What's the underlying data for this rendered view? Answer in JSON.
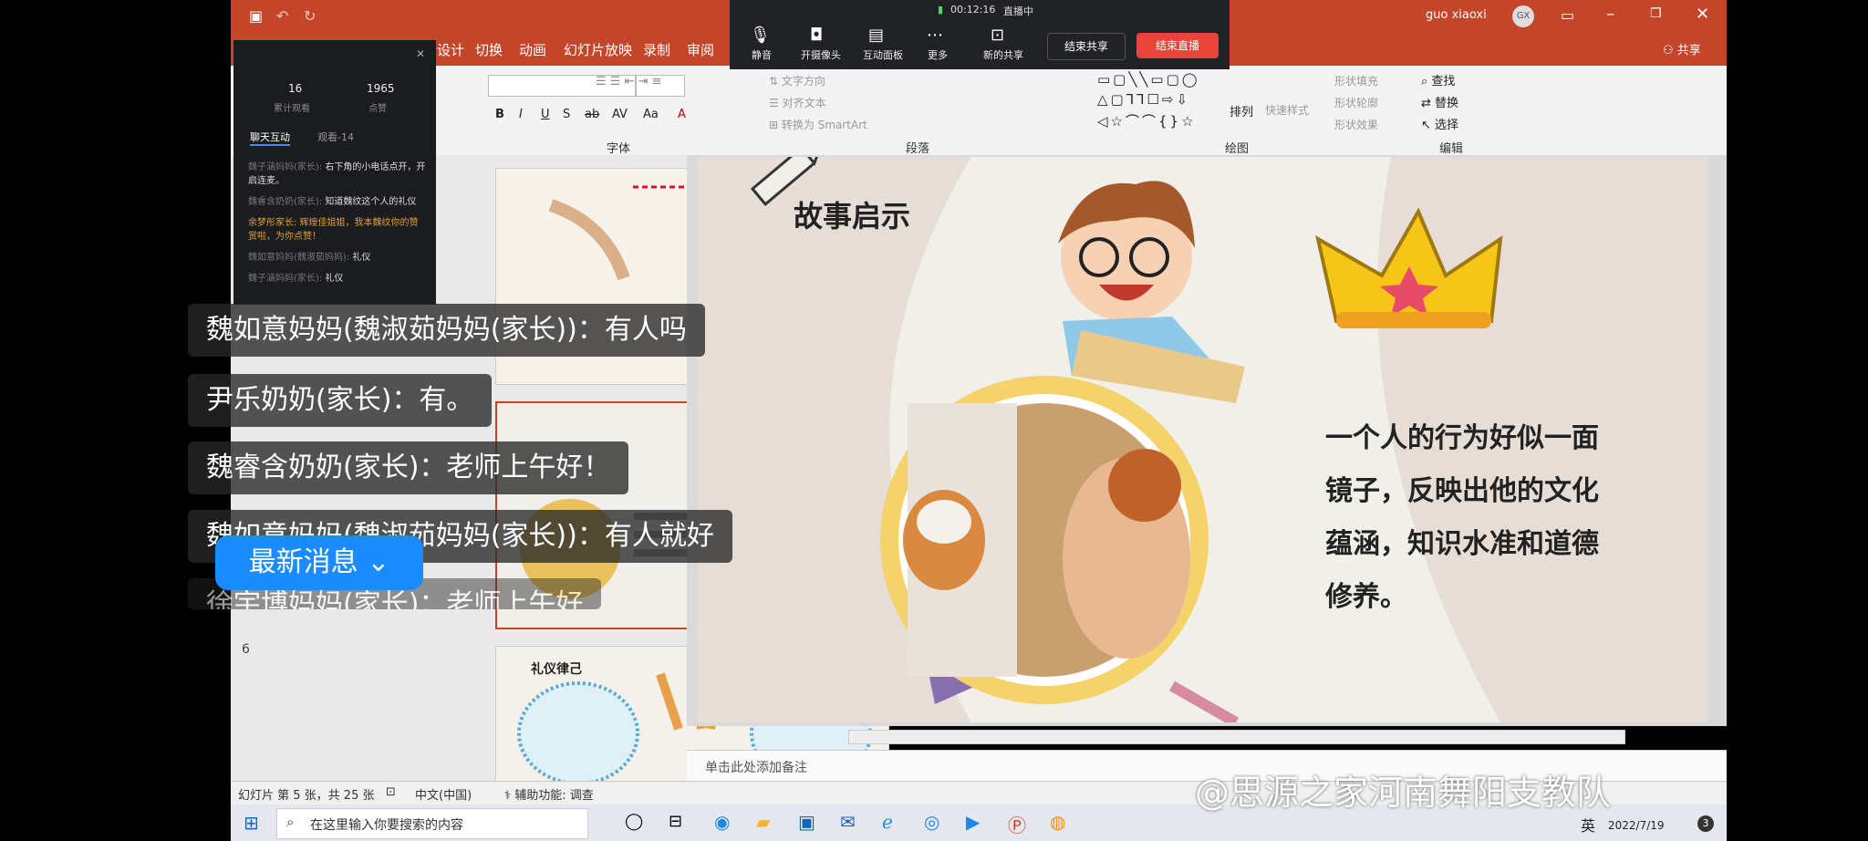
{
  "app": {
    "user_name": "guo xiaoxi",
    "user_initials": "GX",
    "share_label": "共享",
    "tabs": [
      "设计",
      "切换",
      "动画",
      "幻灯片放映",
      "录制",
      "审阅"
    ]
  },
  "meeting": {
    "timer": "00:12:16",
    "live_status": "直播中",
    "buttons": [
      "静音",
      "开摄像头",
      "互动面板",
      "更多",
      "新的共享"
    ],
    "stop_share": "结束共享",
    "end_live": "结束直播"
  },
  "ribbon": {
    "groups": [
      "字体",
      "段落",
      "绘图",
      "编辑"
    ],
    "font_buttons": [
      "B",
      "I",
      "U",
      "S",
      "ab",
      "AV",
      "Aa",
      "A"
    ],
    "para_items": [
      "文字方向",
      "对齐文本",
      "转换为 SmartArt"
    ],
    "draw_items": [
      "排列",
      "快速样式",
      "形状填充",
      "形状轮廓",
      "形状效果"
    ],
    "edit_items": [
      "查找",
      "替换",
      "选择"
    ]
  },
  "panel": {
    "stats": [
      {
        "value": "16",
        "label": "累计观看"
      },
      {
        "value": "1965",
        "label": "点赞"
      }
    ],
    "tabs": [
      "聊天互动",
      "观看-14"
    ],
    "messages": [
      {
        "user": "魏子涵妈妈(家长):",
        "text": "右下角的小电话点开，开启连麦。"
      },
      {
        "user": "魏睿含奶奶(家长):",
        "text": "知道魏纹这个人的礼仪"
      },
      {
        "user": "余梦彤家长:",
        "text": "辉煌佳姐姐，我本魏纹你的赞赏啦，为你点赞！"
      },
      {
        "user": "魏如意妈妈(魏淑茹妈妈):",
        "text": "礼仪"
      },
      {
        "user": "魏子涵妈妈(家长):",
        "text": "礼仪"
      }
    ]
  },
  "chat_overlay": [
    "魏如意妈妈(魏淑茹妈妈(家长))：有人吗",
    "尹乐奶奶(家长)：有。",
    "魏睿含奶奶(家长)：老师上午好！",
    "魏如意妈妈(魏淑茹妈妈(家长))：有人就好",
    "徐宇博妈妈(家长)：老师上午好"
  ],
  "new_message_button": "最新消息",
  "slide": {
    "title": "故事启示",
    "body": [
      "一个人的行为好似一面",
      "镜子，反映出他的文化",
      "蕴涵，知识水准和道德",
      "修养。"
    ]
  },
  "thumbs": {
    "slide6_number": "6",
    "slide6_title": "礼仪律己"
  },
  "notes_placeholder": "单击此处添加备注",
  "status": {
    "slide_info": "幻灯片 第 5 张，共 25 张",
    "language": "中文(中国)",
    "accessibility": "辅助功能: 调查"
  },
  "taskbar": {
    "search_placeholder": "在这里输入你要搜索的内容",
    "ime": "英",
    "date": "2022/7/19",
    "notif_count": "3"
  },
  "watermark": "@思源之家河南舞阳支教队",
  "colors": {
    "accent": "#c4452a",
    "live_end": "#e8443a",
    "new_msg": "#1a8cff"
  }
}
